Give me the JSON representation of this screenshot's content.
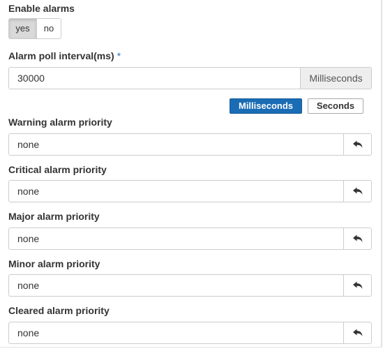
{
  "enable_alarms": {
    "label": "Enable alarms",
    "options": [
      "yes",
      "no"
    ],
    "selected": "yes"
  },
  "poll_interval": {
    "label": "Alarm poll interval(ms)",
    "required_mark": "*",
    "value": "30000",
    "unit_addon": "Milliseconds",
    "unit_buttons": [
      "Milliseconds",
      "Seconds"
    ],
    "active_unit": "Milliseconds"
  },
  "priorities": [
    {
      "label": "Warning alarm priority",
      "value": "none"
    },
    {
      "label": "Critical alarm priority",
      "value": "none"
    },
    {
      "label": "Major alarm priority",
      "value": "none"
    },
    {
      "label": "Minor alarm priority",
      "value": "none"
    },
    {
      "label": "Cleared alarm priority",
      "value": "none"
    }
  ],
  "icons": {
    "reset": "undo-arrow-icon"
  },
  "colors": {
    "active_unit": "#1a6cb5",
    "toggle_selected": "#d9d9d9",
    "addon_bg": "#eeeeee"
  }
}
